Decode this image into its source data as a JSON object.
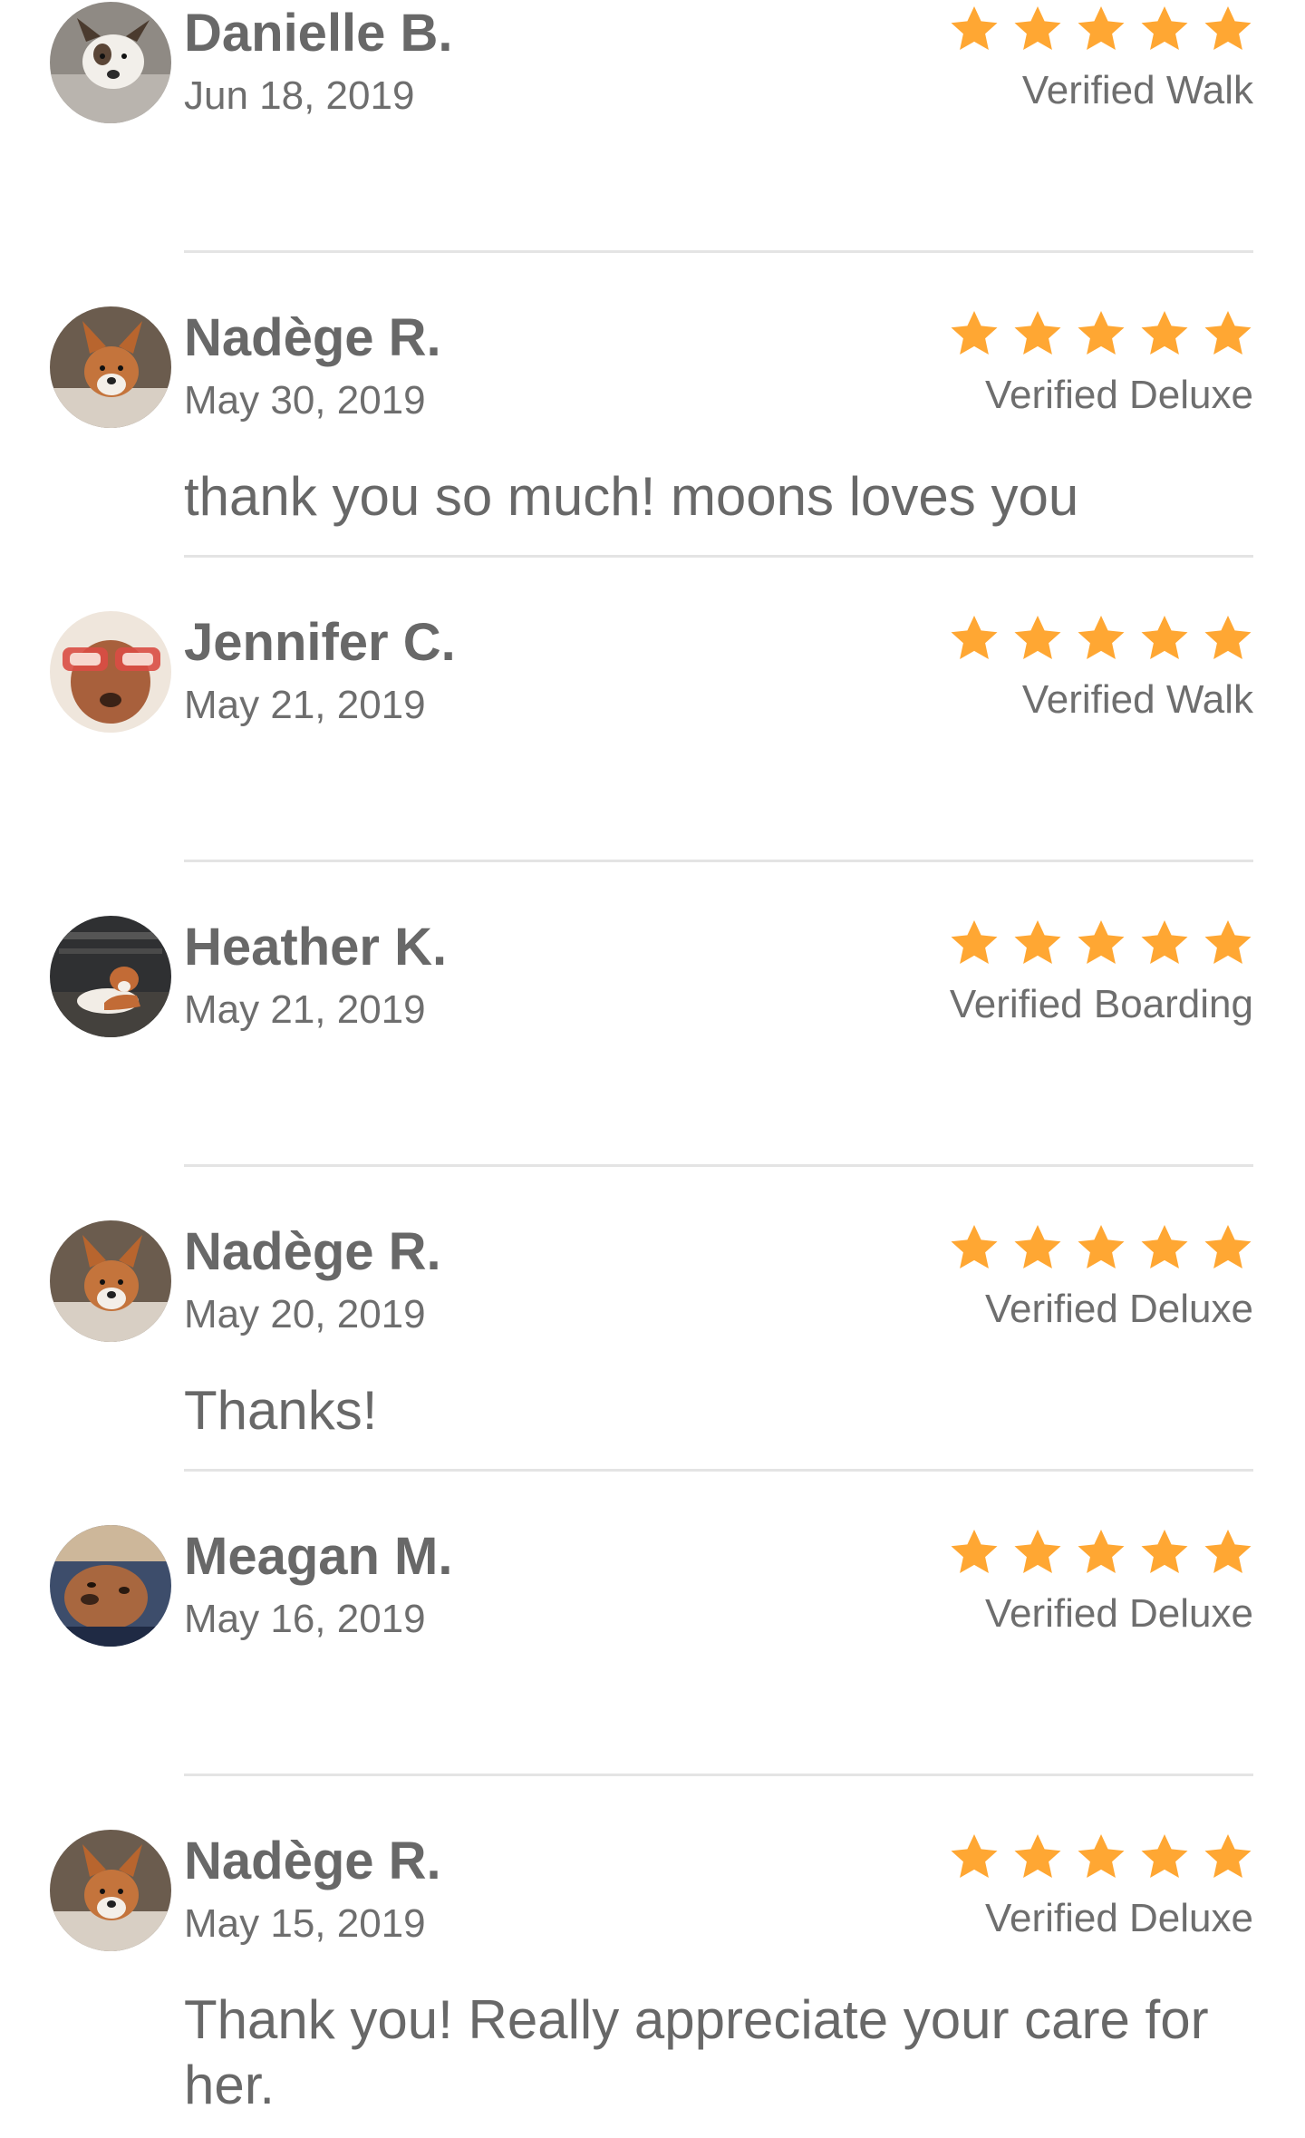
{
  "colors": {
    "star": "#ffa733",
    "text": "#686868",
    "divider": "#e4e4e4"
  },
  "reviews": [
    {
      "name": "Danielle B.",
      "date": "Jun 18, 2019",
      "rating": 5,
      "service": "Verified Walk",
      "comment": "",
      "avatar_icon": "dog-avatar-icon"
    },
    {
      "name": "Nadège R.",
      "date": "May 30, 2019",
      "rating": 5,
      "service": "Verified Deluxe",
      "comment": "thank you so much! moons loves you",
      "avatar_icon": "dog-avatar-icon"
    },
    {
      "name": "Jennifer C.",
      "date": "May 21, 2019",
      "rating": 5,
      "service": "Verified Walk",
      "comment": "",
      "avatar_icon": "dog-avatar-icon"
    },
    {
      "name": "Heather K.",
      "date": "May 21, 2019",
      "rating": 5,
      "service": "Verified Boarding",
      "comment": "",
      "avatar_icon": "dog-avatar-icon"
    },
    {
      "name": "Nadège R.",
      "date": "May 20, 2019",
      "rating": 5,
      "service": "Verified Deluxe",
      "comment": "Thanks!",
      "avatar_icon": "dog-avatar-icon"
    },
    {
      "name": "Meagan M.",
      "date": "May 16, 2019",
      "rating": 5,
      "service": "Verified Deluxe",
      "comment": "",
      "avatar_icon": "dog-avatar-icon"
    },
    {
      "name": "Nadège R.",
      "date": "May 15, 2019",
      "rating": 5,
      "service": "Verified Deluxe",
      "comment": "Thank you! Really appreciate your care for her.",
      "avatar_icon": "dog-avatar-icon"
    }
  ]
}
